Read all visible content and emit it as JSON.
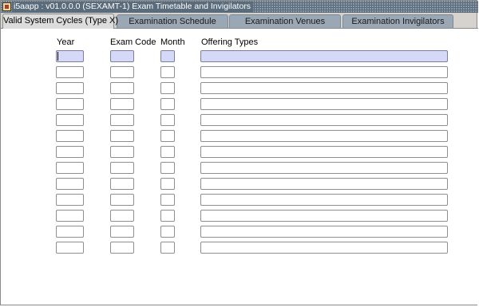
{
  "window": {
    "title": "i5aapp : v01.0.0.0 (SEXAMT-1) Exam Timetable and Invigilators",
    "icon": "app-icon"
  },
  "tabs": [
    {
      "label": "Valid System Cycles (Type X)",
      "active": true
    },
    {
      "label": "Examination Schedule",
      "active": false
    },
    {
      "label": "Examination Venues",
      "active": false
    },
    {
      "label": "Examination Invigilators",
      "active": false
    }
  ],
  "columns": {
    "year": "Year",
    "exam_code": "Exam Code",
    "month": "Month",
    "offering_types": "Offering Types"
  },
  "rows": [
    {
      "year": "",
      "exam_code": "",
      "month": "",
      "offering_types": ""
    },
    {
      "year": "",
      "exam_code": "",
      "month": "",
      "offering_types": ""
    },
    {
      "year": "",
      "exam_code": "",
      "month": "",
      "offering_types": ""
    },
    {
      "year": "",
      "exam_code": "",
      "month": "",
      "offering_types": ""
    },
    {
      "year": "",
      "exam_code": "",
      "month": "",
      "offering_types": ""
    },
    {
      "year": "",
      "exam_code": "",
      "month": "",
      "offering_types": ""
    },
    {
      "year": "",
      "exam_code": "",
      "month": "",
      "offering_types": ""
    },
    {
      "year": "",
      "exam_code": "",
      "month": "",
      "offering_types": ""
    },
    {
      "year": "",
      "exam_code": "",
      "month": "",
      "offering_types": ""
    },
    {
      "year": "",
      "exam_code": "",
      "month": "",
      "offering_types": ""
    },
    {
      "year": "",
      "exam_code": "",
      "month": "",
      "offering_types": ""
    },
    {
      "year": "",
      "exam_code": "",
      "month": "",
      "offering_types": ""
    },
    {
      "year": "",
      "exam_code": "",
      "month": "",
      "offering_types": ""
    }
  ],
  "colors": {
    "title_bar": "#5a6b7b",
    "inactive_tab": "#9aa7b5",
    "active_tab": "#dcdcdc",
    "current_record": "#d6d8f8"
  }
}
